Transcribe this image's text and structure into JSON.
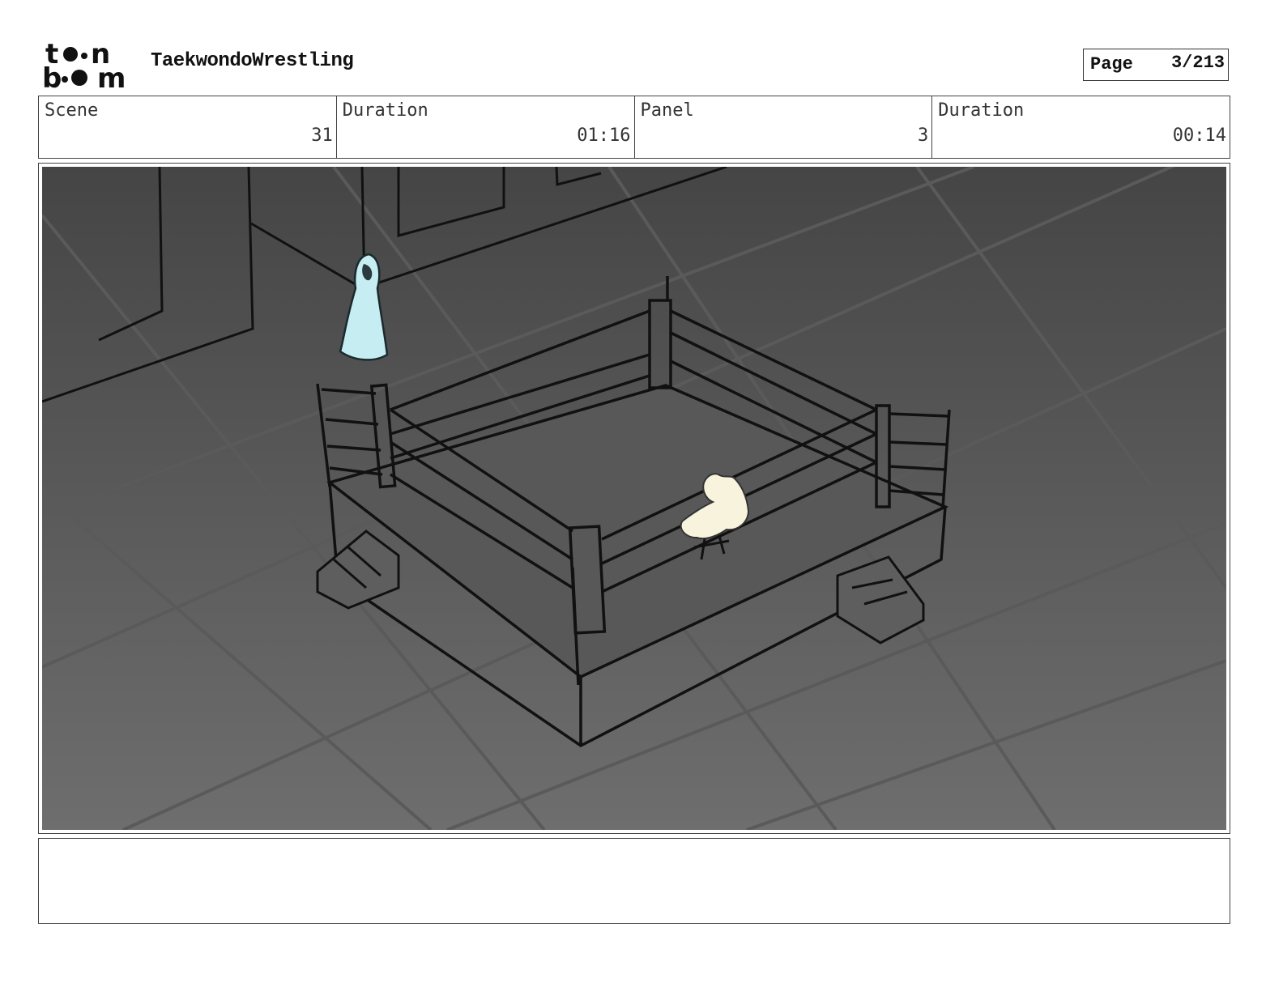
{
  "logo": {
    "line1": "toon",
    "line2": "boom",
    "icon": "toon-boom-logo"
  },
  "project": {
    "title": "TaekwondoWrestling"
  },
  "page": {
    "label": "Page",
    "value": "3/213"
  },
  "info": {
    "scene_label": "Scene",
    "scene_value": "31",
    "duration_label": "Duration",
    "duration_value": "01:16",
    "panel_label": "Panel",
    "panel_value": "3",
    "panel_duration_label": "Duration",
    "panel_duration_value": "00:14"
  },
  "panel": {
    "description": "Storyboard sketch: wrestling ring with cloaked ghost figure and seated cat-like character",
    "colors": {
      "floor_top": "#454545",
      "floor_bottom": "#6e6e6e",
      "ghost": "#c6eef2",
      "cat": "#f7f3dc"
    }
  },
  "notes": {
    "text": ""
  }
}
